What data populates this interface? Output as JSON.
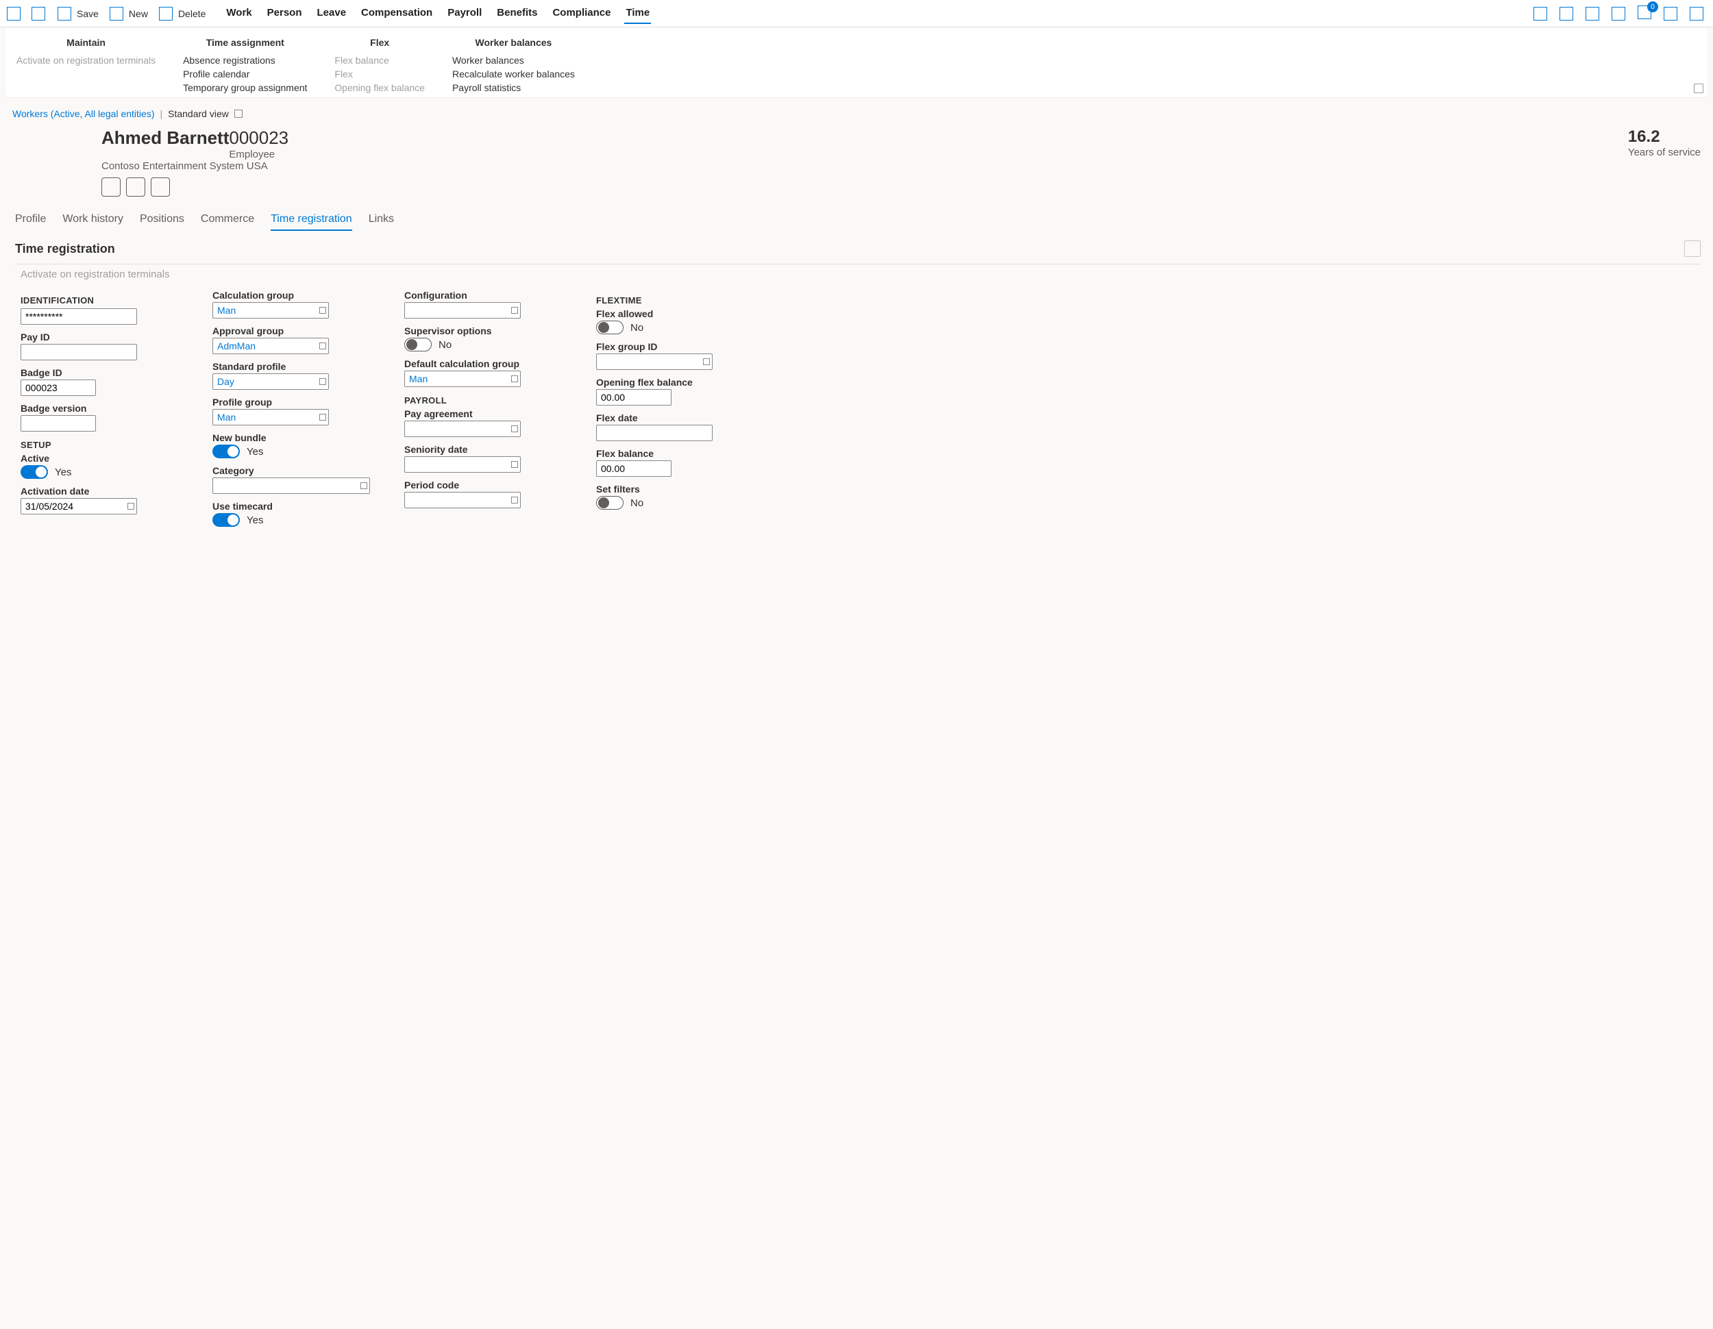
{
  "actionBar": {
    "save": "Save",
    "new": "New",
    "delete": "Delete"
  },
  "navTabs": [
    "Work",
    "Person",
    "Leave",
    "Compensation",
    "Payroll",
    "Benefits",
    "Compliance",
    "Time"
  ],
  "navActiveIndex": 7,
  "notifCount": "0",
  "ribbon": {
    "groups": [
      {
        "title": "Maintain",
        "items": [
          {
            "label": "Activate on registration terminals",
            "disabled": true
          }
        ]
      },
      {
        "title": "Time assignment",
        "items": [
          {
            "label": "Absence registrations"
          },
          {
            "label": "Profile calendar"
          },
          {
            "label": "Temporary group assignment"
          }
        ]
      },
      {
        "title": "Flex",
        "items": [
          {
            "label": "Flex balance",
            "disabled": true
          },
          {
            "label": "Flex",
            "disabled": true
          },
          {
            "label": "Opening flex balance",
            "disabled": true
          }
        ]
      },
      {
        "title": "Worker balances",
        "items": [
          {
            "label": "Worker balances"
          },
          {
            "label": "Recalculate worker balances"
          },
          {
            "label": "Payroll statistics"
          }
        ]
      }
    ]
  },
  "crumb": {
    "link": "Workers (Active, All legal entities)",
    "view": "Standard view"
  },
  "header": {
    "name": "Ahmed Barnett",
    "personnel": "000023",
    "role": "Employee",
    "company": "Contoso Entertainment System USA",
    "yosValue": "16.2",
    "yosLabel": "Years of service"
  },
  "detailTabs": [
    "Profile",
    "Work history",
    "Positions",
    "Commerce",
    "Time registration",
    "Links"
  ],
  "detailActiveIndex": 4,
  "section": {
    "title": "Time registration",
    "activateLink": "Activate on registration terminals"
  },
  "form": {
    "identification": {
      "heading": "IDENTIFICATION",
      "masked": "**********",
      "payIdLabel": "Pay ID",
      "payId": "",
      "badgeIdLabel": "Badge ID",
      "badgeId": "000023",
      "badgeVerLabel": "Badge version",
      "badgeVer": ""
    },
    "setup": {
      "heading": "SETUP",
      "activeLabel": "Active",
      "activeVal": "Yes",
      "activationDateLabel": "Activation date",
      "activationDate": "31/05/2024",
      "calcGroupLabel": "Calculation group",
      "calcGroup": "Man",
      "approvalGroupLabel": "Approval group",
      "approvalGroup": "AdmMan",
      "stdProfileLabel": "Standard profile",
      "stdProfile": "Day",
      "profileGroupLabel": "Profile group",
      "profileGroup": "Man",
      "newBundleLabel": "New bundle",
      "newBundleVal": "Yes",
      "categoryLabel": "Category",
      "category": "",
      "useTimecardLabel": "Use timecard",
      "useTimecardVal": "Yes",
      "configLabel": "Configuration",
      "config": "",
      "supervisorLabel": "Supervisor options",
      "supervisorVal": "No",
      "defCalcGroupLabel": "Default calculation group",
      "defCalcGroup": "Man"
    },
    "payroll": {
      "heading": "PAYROLL",
      "payAgreementLabel": "Pay agreement",
      "payAgreement": "",
      "seniorityLabel": "Seniority date",
      "seniority": "",
      "periodCodeLabel": "Period code",
      "periodCode": ""
    },
    "flextime": {
      "heading": "FLEXTIME",
      "flexAllowedLabel": "Flex allowed",
      "flexAllowedVal": "No",
      "flexGroupIdLabel": "Flex group ID",
      "flexGroupId": "",
      "openingFlexLabel": "Opening flex balance",
      "openingFlex": "00.00",
      "flexDateLabel": "Flex date",
      "flexDate": "",
      "flexBalanceLabel": "Flex balance",
      "flexBalance": "00.00",
      "setFiltersLabel": "Set filters",
      "setFiltersVal": "No"
    }
  }
}
